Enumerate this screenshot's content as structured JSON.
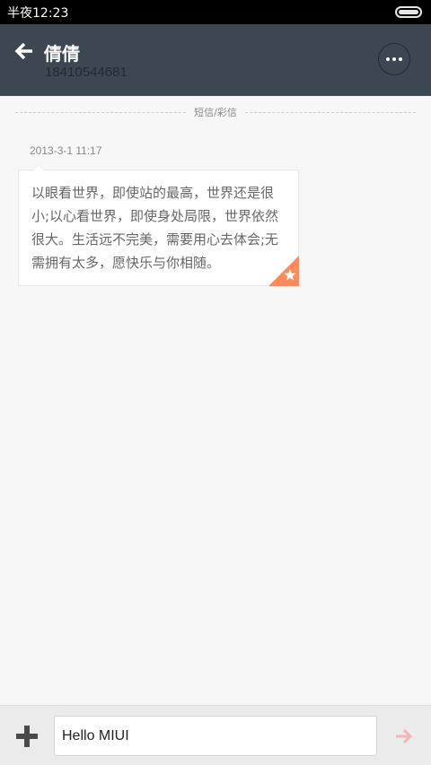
{
  "status_bar": {
    "time": "半夜12:23",
    "battery_icon": "battery-full-icon"
  },
  "header": {
    "back_icon": "arrow-left-icon",
    "contact_name": "倩倩",
    "contact_number": "18410544681",
    "more_icon": "more-dots-icon"
  },
  "thread": {
    "channel_label": "短信/彩信",
    "messages": [
      {
        "time": "2013-3-1 11:17",
        "text": "以眼看世界，即使站的最高，世界还是很小;以心看世界，即使身处局限，世界依然很大。生活远不完美，需要用心去体会;无需拥有太多，愿快乐与你相随。",
        "starred": true,
        "star_color": "#ff8a5c"
      }
    ]
  },
  "composer": {
    "add_icon": "plus-icon",
    "input_value": "Hello MIUI",
    "send_icon": "arrow-right-icon",
    "send_color": "#f4b6b6"
  },
  "colors": {
    "header_bg": "#3c4751",
    "page_bg": "#f7f7f7",
    "status_bg": "#000000"
  }
}
